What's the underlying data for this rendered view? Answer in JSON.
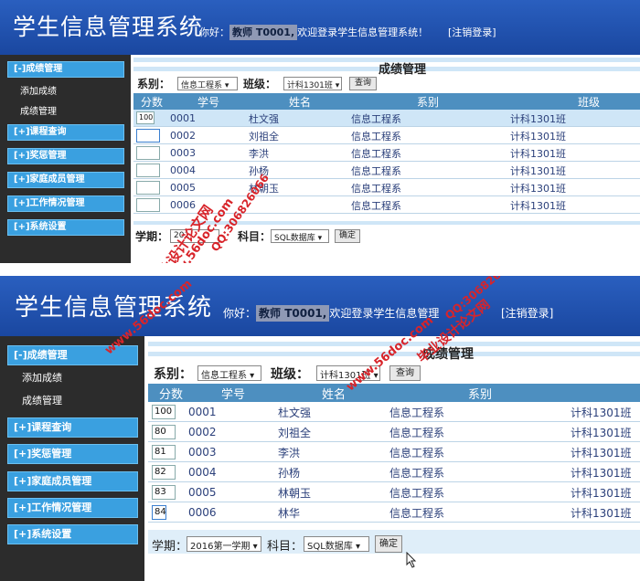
{
  "app": {
    "title": "学生信息管理系统",
    "greeting_prefix": "你好：",
    "user": "教师  T0001,",
    "greeting_suffix": "欢迎登录学生信息管理系统！",
    "greeting_suffix_cut": "欢迎登录学生信息管理",
    "logout": "[注销登录]"
  },
  "sidebar": {
    "groups": [
      {
        "label": "[-]成绩管理",
        "items": [
          "添加成绩",
          "成绩管理"
        ]
      },
      {
        "label": "[+]课程查询",
        "items": []
      },
      {
        "label": "[+]奖惩管理",
        "items": []
      },
      {
        "label": "[+]家庭成员管理",
        "items": []
      },
      {
        "label": "[+]工作情况管理",
        "items": []
      },
      {
        "label": "[+]系统设置",
        "items": []
      }
    ]
  },
  "page": {
    "title": "成绩管理",
    "dept_label": "系别：",
    "dept_value": "信息工程系 ▾",
    "class_label": "班级：",
    "class_value": "计科1301班 ▾",
    "query_button": "查询",
    "columns": [
      "分数",
      "学号",
      "姓名",
      "系别",
      "班级"
    ],
    "rows": [
      {
        "id": "0001",
        "name": "杜文强",
        "dept": "信息工程系",
        "class": "计科1301班"
      },
      {
        "id": "0002",
        "name": "刘祖全",
        "dept": "信息工程系",
        "class": "计科1301班"
      },
      {
        "id": "0003",
        "name": "李洪",
        "dept": "信息工程系",
        "class": "计科1301班"
      },
      {
        "id": "0004",
        "name": "孙杨",
        "dept": "信息工程系",
        "class": "计科1301班"
      },
      {
        "id": "0005",
        "name": "林朝玉",
        "dept": "信息工程系",
        "class": "计科1301班"
      },
      {
        "id": "0006",
        "name": "林华",
        "dept": "信息工程系",
        "class": "计科1301班"
      }
    ],
    "top_row_5_name": "林朝玉",
    "top_row_6_name": "",
    "top_scores": [
      "100",
      "",
      "",
      "",
      "",
      ""
    ],
    "bottom_scores": [
      "100",
      "80",
      "81",
      "82",
      "83",
      "84"
    ],
    "term_label": "学期：",
    "term_value_top": "201",
    "term_value": "2016第一学期 ▾",
    "subject_label": "科目：",
    "subject_value": "SQL数据库 ▾",
    "confirm_button": "确定"
  },
  "watermarks": {
    "a": "毕业设计论文网",
    "b": "www.56doc.com",
    "c": "QQ:306826066"
  },
  "colors": {
    "header_blue": "#1f4fa8",
    "sidebar_dark": "#2c2c2c",
    "menu_blue": "#3aa0e0",
    "table_header": "#4d8fc0",
    "watermark_red": "#d8242a"
  }
}
